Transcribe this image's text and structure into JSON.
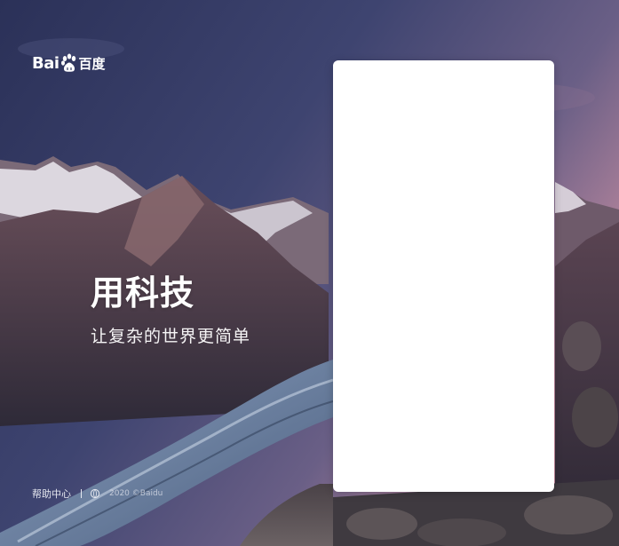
{
  "brand": {
    "logo_latin": "Bai",
    "logo_cn": "百度",
    "paw_icon": "paw-icon"
  },
  "hero": {
    "title": "用科技",
    "subtitle": "让复杂的世界更简单"
  },
  "footer": {
    "help_label": "帮助中心",
    "copyright": "2020 ©Baidu",
    "globe_icon": "globe-icon"
  },
  "colors": {
    "text": "#ffffff",
    "panel_bg": "#ffffff",
    "sky_top": "#2f3660",
    "sky_glow": "#c48a9e"
  }
}
